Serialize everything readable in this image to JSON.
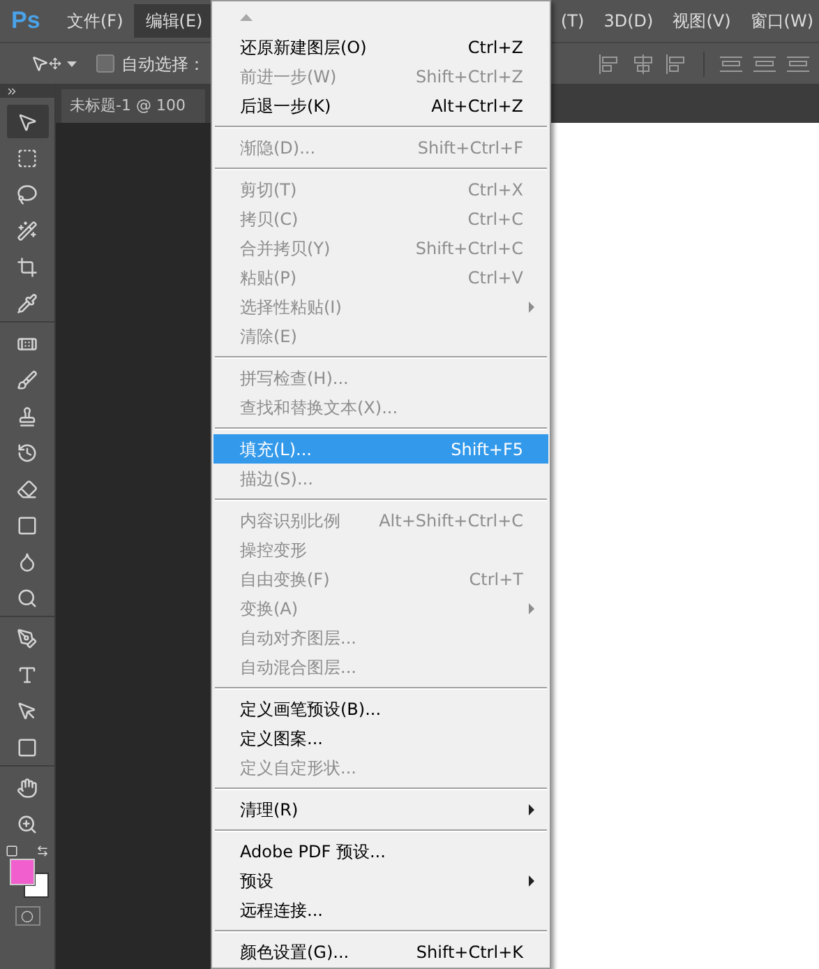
{
  "logo": "Ps",
  "menubar": [
    {
      "label": "文件(F)",
      "selected": false
    },
    {
      "label": "编辑(E)",
      "selected": true
    },
    {
      "label": "(T)",
      "selected": false
    },
    {
      "label": "3D(D)",
      "selected": false
    },
    {
      "label": "视图(V)",
      "selected": false
    },
    {
      "label": "窗口(W)",
      "selected": false
    }
  ],
  "options_bar": {
    "auto_select": {
      "label": "自动选择：",
      "checked": false
    }
  },
  "document_tab": {
    "title": "未标题-1 @ 100"
  },
  "tools": [
    {
      "kind": "move",
      "selected": true
    },
    {
      "kind": "marquee",
      "selected": false
    },
    {
      "kind": "lasso",
      "selected": false
    },
    {
      "kind": "quick-select",
      "selected": false
    },
    {
      "kind": "crop",
      "selected": false
    },
    {
      "kind": "eyedropper",
      "selected": false
    },
    {
      "kind": "healing",
      "selected": false
    },
    {
      "kind": "brush",
      "selected": false
    },
    {
      "kind": "stamp",
      "selected": false
    },
    {
      "kind": "history-brush",
      "selected": false
    },
    {
      "kind": "eraser",
      "selected": false
    },
    {
      "kind": "gradient",
      "selected": false
    },
    {
      "kind": "blur",
      "selected": false
    },
    {
      "kind": "dodge",
      "selected": false
    },
    {
      "kind": "pen",
      "selected": false
    },
    {
      "kind": "type",
      "selected": false
    },
    {
      "kind": "path-select",
      "selected": false
    },
    {
      "kind": "shape",
      "selected": false
    },
    {
      "kind": "hand",
      "selected": false
    },
    {
      "kind": "zoom",
      "selected": false
    }
  ],
  "swatches": {
    "foreground": {
      "color": "#f15fcf"
    },
    "background": {
      "color": "#ffffff"
    }
  },
  "edit_menu": [
    {
      "kind": "item",
      "label": "还原新建图层(O)",
      "shortcut": "Ctrl+Z",
      "disabled": false,
      "selected": false,
      "submenu": false
    },
    {
      "kind": "item",
      "label": "前进一步(W)",
      "shortcut": "Shift+Ctrl+Z",
      "disabled": true,
      "selected": false,
      "submenu": false
    },
    {
      "kind": "item",
      "label": "后退一步(K)",
      "shortcut": "Alt+Ctrl+Z",
      "disabled": false,
      "selected": false,
      "submenu": false
    },
    {
      "kind": "separator"
    },
    {
      "kind": "item",
      "label": "渐隐(D)...",
      "shortcut": "Shift+Ctrl+F",
      "disabled": true,
      "selected": false,
      "submenu": false
    },
    {
      "kind": "separator"
    },
    {
      "kind": "item",
      "label": "剪切(T)",
      "shortcut": "Ctrl+X",
      "disabled": true,
      "selected": false,
      "submenu": false
    },
    {
      "kind": "item",
      "label": "拷贝(C)",
      "shortcut": "Ctrl+C",
      "disabled": true,
      "selected": false,
      "submenu": false
    },
    {
      "kind": "item",
      "label": "合并拷贝(Y)",
      "shortcut": "Shift+Ctrl+C",
      "disabled": true,
      "selected": false,
      "submenu": false
    },
    {
      "kind": "item",
      "label": "粘贴(P)",
      "shortcut": "Ctrl+V",
      "disabled": true,
      "selected": false,
      "submenu": false
    },
    {
      "kind": "item",
      "label": "选择性粘贴(I)",
      "disabled": true,
      "selected": false,
      "submenu": true
    },
    {
      "kind": "item",
      "label": "清除(E)",
      "disabled": true,
      "selected": false,
      "submenu": false
    },
    {
      "kind": "separator"
    },
    {
      "kind": "item",
      "label": "拼写检查(H)...",
      "disabled": true,
      "selected": false,
      "submenu": false
    },
    {
      "kind": "item",
      "label": "查找和替换文本(X)...",
      "disabled": true,
      "selected": false,
      "submenu": false
    },
    {
      "kind": "separator"
    },
    {
      "kind": "item",
      "label": "填充(L)...",
      "shortcut": "Shift+F5",
      "disabled": false,
      "selected": true,
      "submenu": false
    },
    {
      "kind": "item",
      "label": "描边(S)...",
      "disabled": true,
      "selected": false,
      "submenu": false
    },
    {
      "kind": "separator"
    },
    {
      "kind": "item",
      "label": "内容识别比例",
      "shortcut": "Alt+Shift+Ctrl+C",
      "disabled": true,
      "selected": false,
      "submenu": false
    },
    {
      "kind": "item",
      "label": "操控变形",
      "disabled": true,
      "selected": false,
      "submenu": false
    },
    {
      "kind": "item",
      "label": "自由变换(F)",
      "shortcut": "Ctrl+T",
      "disabled": true,
      "selected": false,
      "submenu": false
    },
    {
      "kind": "item",
      "label": "变换(A)",
      "disabled": true,
      "selected": false,
      "submenu": true
    },
    {
      "kind": "item",
      "label": "自动对齐图层...",
      "disabled": true,
      "selected": false,
      "submenu": false
    },
    {
      "kind": "item",
      "label": "自动混合图层...",
      "disabled": true,
      "selected": false,
      "submenu": false
    },
    {
      "kind": "separator"
    },
    {
      "kind": "item",
      "label": "定义画笔预设(B)...",
      "disabled": false,
      "selected": false,
      "submenu": false
    },
    {
      "kind": "item",
      "label": "定义图案...",
      "disabled": false,
      "selected": false,
      "submenu": false
    },
    {
      "kind": "item",
      "label": "定义自定形状...",
      "disabled": true,
      "selected": false,
      "submenu": false
    },
    {
      "kind": "separator"
    },
    {
      "kind": "item",
      "label": "清理(R)",
      "disabled": false,
      "selected": false,
      "submenu": true
    },
    {
      "kind": "separator"
    },
    {
      "kind": "item",
      "label": "Adobe PDF 预设...",
      "disabled": false,
      "selected": false,
      "submenu": false
    },
    {
      "kind": "item",
      "label": "预设",
      "disabled": false,
      "selected": false,
      "submenu": true
    },
    {
      "kind": "item",
      "label": "远程连接...",
      "disabled": false,
      "selected": false,
      "submenu": false
    },
    {
      "kind": "separator"
    },
    {
      "kind": "item",
      "label": "颜色设置(G)...",
      "shortcut": "Shift+Ctrl+K",
      "disabled": false,
      "selected": false,
      "submenu": false
    }
  ]
}
